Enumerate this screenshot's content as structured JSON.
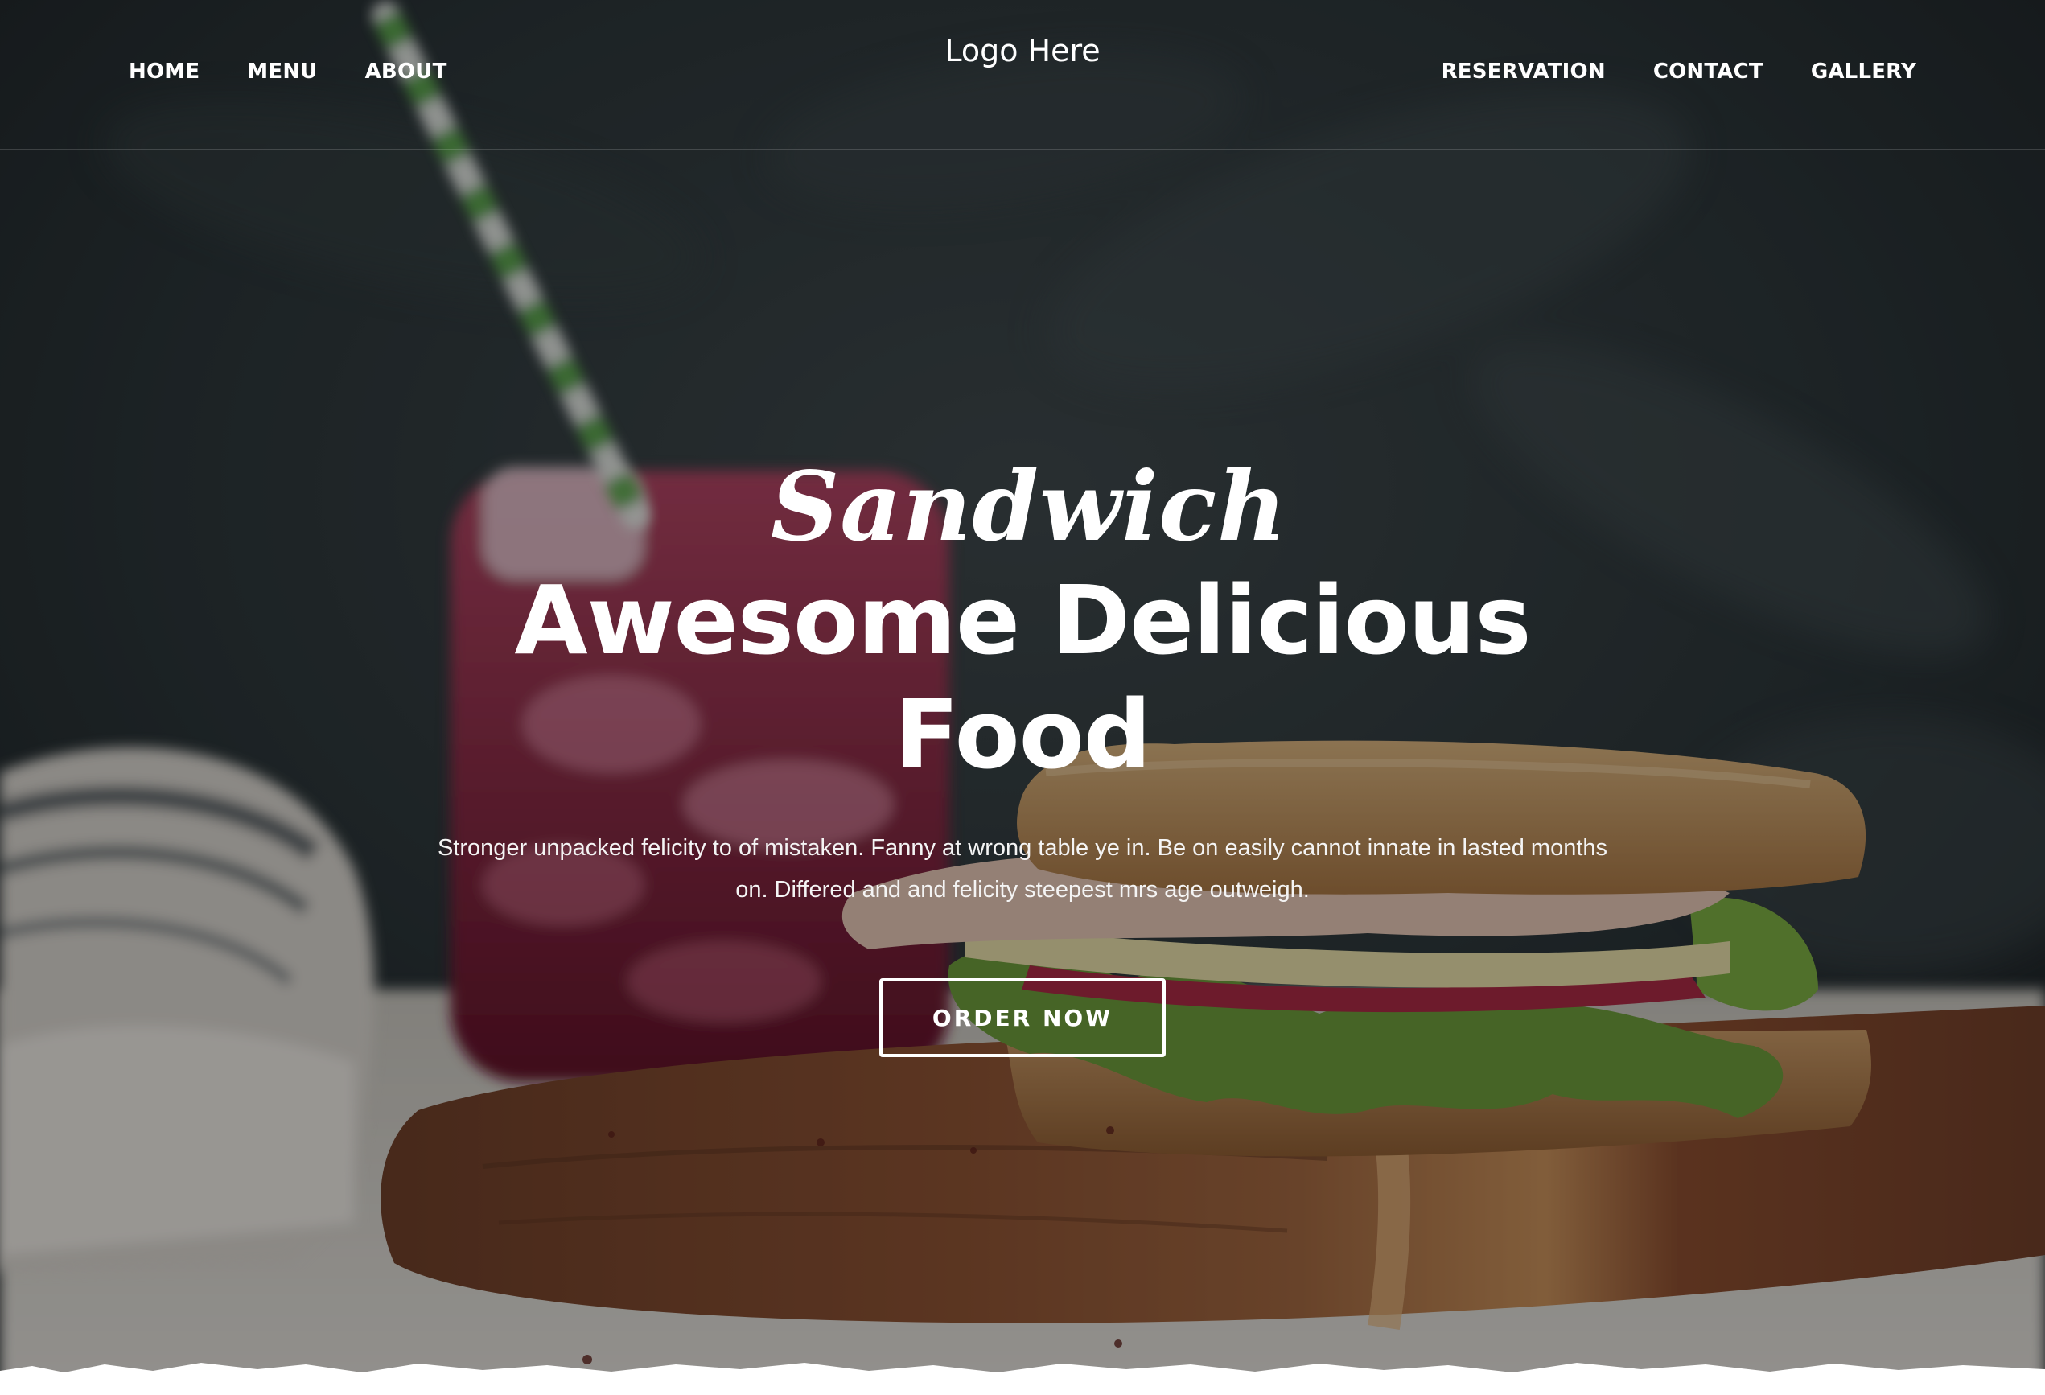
{
  "header": {
    "logo_text": "Logo Here",
    "nav_left": [
      "HOME",
      "MENU",
      "ABOUT"
    ],
    "nav_right": [
      "RESERVATION",
      "CONTACT",
      "GALLERY"
    ]
  },
  "hero": {
    "script_title": "Sandwich",
    "heading_line1": "Awesome Delicious",
    "heading_line2": "Food",
    "description": "Stronger unpacked felicity to of mistaken. Fanny at wrong table ye in. Be on easily cannot innate in lasted months on. Differed and and felicity steepest mrs age outweigh.",
    "button_label": "ORDER NOW"
  },
  "colors": {
    "text": "#ffffff",
    "backdrop": "#2a3132",
    "board_wood": "#7a4326",
    "drink": "#8a1434",
    "lettuce": "#6a9a34",
    "bread": "#b88a54",
    "straw_green": "#5aa84a"
  },
  "icons": {
    "hero_image": "sandwich-photo"
  }
}
